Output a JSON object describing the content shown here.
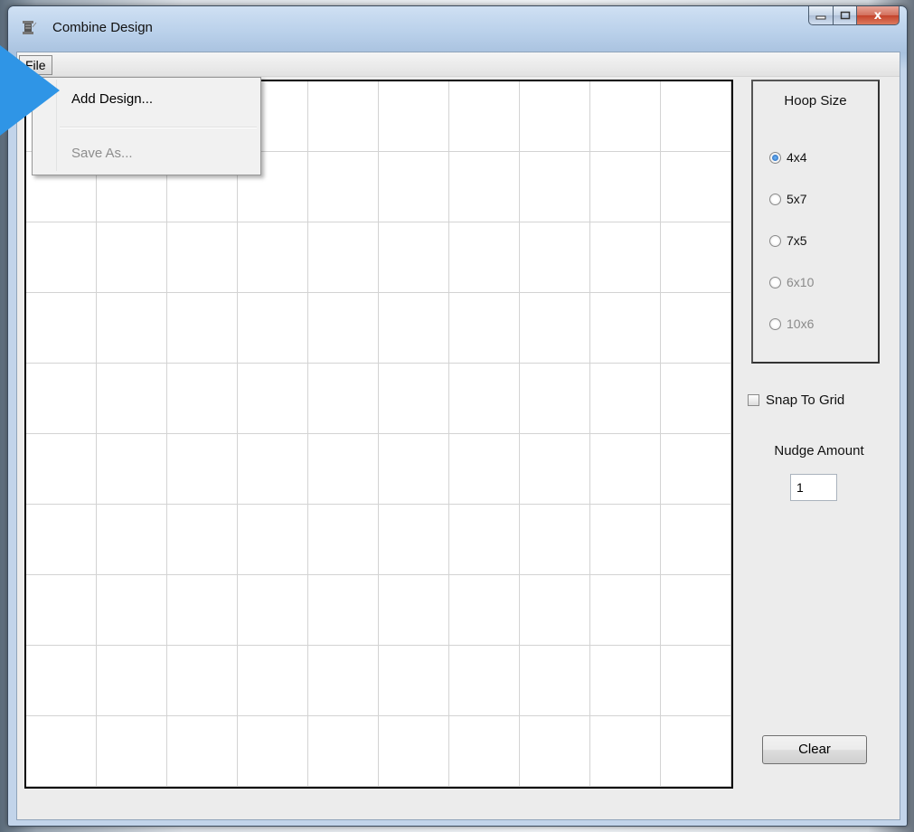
{
  "window": {
    "title": "Combine Design",
    "close_glyph": "x"
  },
  "menubar": {
    "file_label": "File"
  },
  "file_menu": {
    "items": [
      {
        "label": "Add Design...",
        "enabled": true
      },
      {
        "label": "Save As...",
        "enabled": false
      }
    ]
  },
  "hoop_size": {
    "title": "Hoop Size",
    "options": [
      {
        "label": "4x4",
        "checked": true,
        "enabled": true
      },
      {
        "label": "5x7",
        "checked": false,
        "enabled": true
      },
      {
        "label": "7x5",
        "checked": false,
        "enabled": true
      },
      {
        "label": "6x10",
        "checked": false,
        "enabled": false
      },
      {
        "label": "10x6",
        "checked": false,
        "enabled": false
      }
    ]
  },
  "snap_to_grid": {
    "label": "Snap To Grid",
    "checked": false
  },
  "nudge": {
    "label": "Nudge Amount",
    "value": "1"
  },
  "clear_button": {
    "label": "Clear"
  },
  "icons": {
    "app": "spool-icon",
    "pointer": "arrow-pointer-icon"
  },
  "colors": {
    "pointer_blue": "#2f95e6",
    "radio_checked": "#1f5fb5",
    "close_red": "#c4432b"
  }
}
